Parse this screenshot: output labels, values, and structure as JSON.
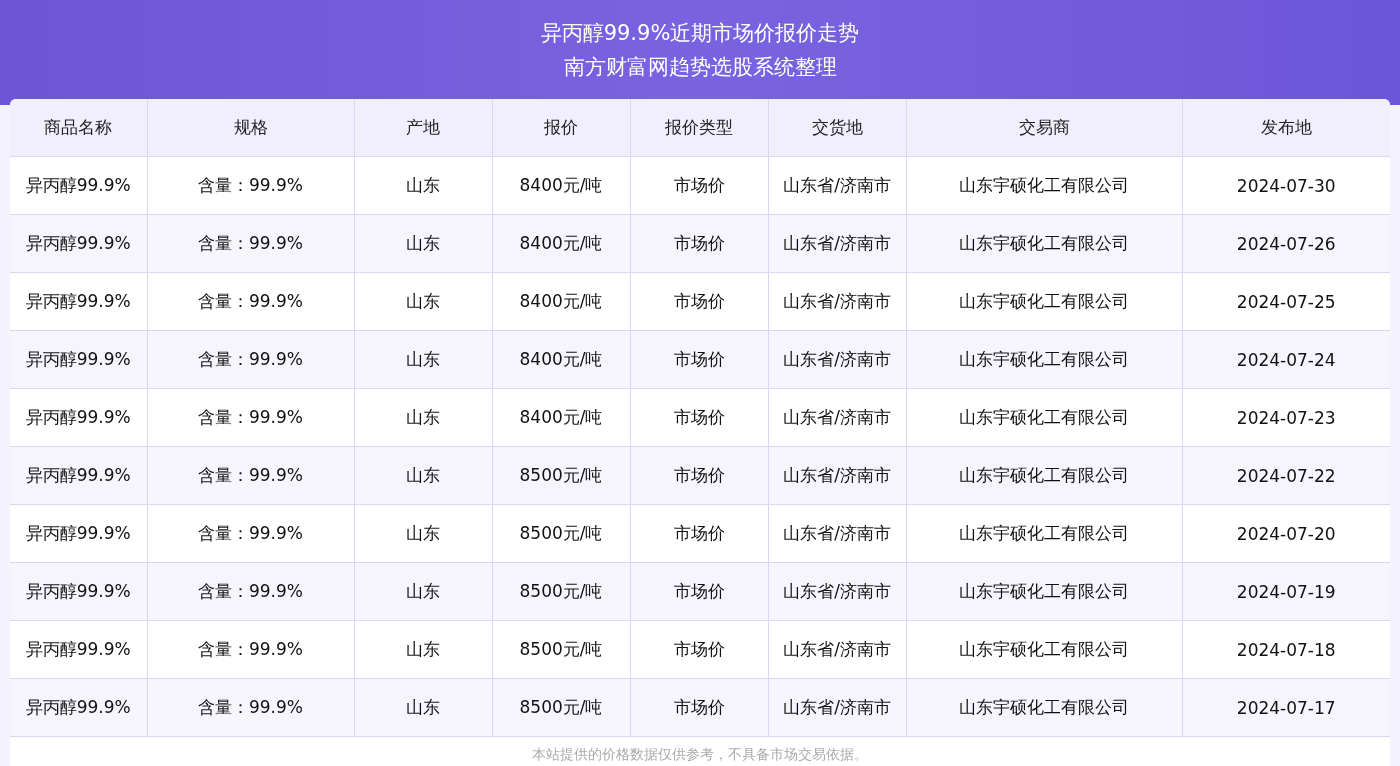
{
  "header": {
    "title": "异丙醇99.9%近期市场价报价走势",
    "subtitle": "南方财富网趋势选股系统整理"
  },
  "table": {
    "columns": [
      "商品名称",
      "规格",
      "产地",
      "报价",
      "报价类型",
      "交货地",
      "交易商",
      "发布地"
    ],
    "rows": [
      [
        "异丙醇99.9%",
        "含量：99.9%",
        "山东",
        "8400元/吨",
        "市场价",
        "山东省/济南市",
        "山东宇硕化工有限公司",
        "2024-07-30"
      ],
      [
        "异丙醇99.9%",
        "含量：99.9%",
        "山东",
        "8400元/吨",
        "市场价",
        "山东省/济南市",
        "山东宇硕化工有限公司",
        "2024-07-26"
      ],
      [
        "异丙醇99.9%",
        "含量：99.9%",
        "山东",
        "8400元/吨",
        "市场价",
        "山东省/济南市",
        "山东宇硕化工有限公司",
        "2024-07-25"
      ],
      [
        "异丙醇99.9%",
        "含量：99.9%",
        "山东",
        "8400元/吨",
        "市场价",
        "山东省/济南市",
        "山东宇硕化工有限公司",
        "2024-07-24"
      ],
      [
        "异丙醇99.9%",
        "含量：99.9%",
        "山东",
        "8400元/吨",
        "市场价",
        "山东省/济南市",
        "山东宇硕化工有限公司",
        "2024-07-23"
      ],
      [
        "异丙醇99.9%",
        "含量：99.9%",
        "山东",
        "8500元/吨",
        "市场价",
        "山东省/济南市",
        "山东宇硕化工有限公司",
        "2024-07-22"
      ],
      [
        "异丙醇99.9%",
        "含量：99.9%",
        "山东",
        "8500元/吨",
        "市场价",
        "山东省/济南市",
        "山东宇硕化工有限公司",
        "2024-07-20"
      ],
      [
        "异丙醇99.9%",
        "含量：99.9%",
        "山东",
        "8500元/吨",
        "市场价",
        "山东省/济南市",
        "山东宇硕化工有限公司",
        "2024-07-19"
      ],
      [
        "异丙醇99.9%",
        "含量：99.9%",
        "山东",
        "8500元/吨",
        "市场价",
        "山东省/济南市",
        "山东宇硕化工有限公司",
        "2024-07-18"
      ],
      [
        "异丙醇99.9%",
        "含量：99.9%",
        "山东",
        "8500元/吨",
        "市场价",
        "山东省/济南市",
        "山东宇硕化工有限公司",
        "2024-07-17"
      ]
    ]
  },
  "footnote": "本站提供的价格数据仅供参考，不具备市场交易依据。"
}
